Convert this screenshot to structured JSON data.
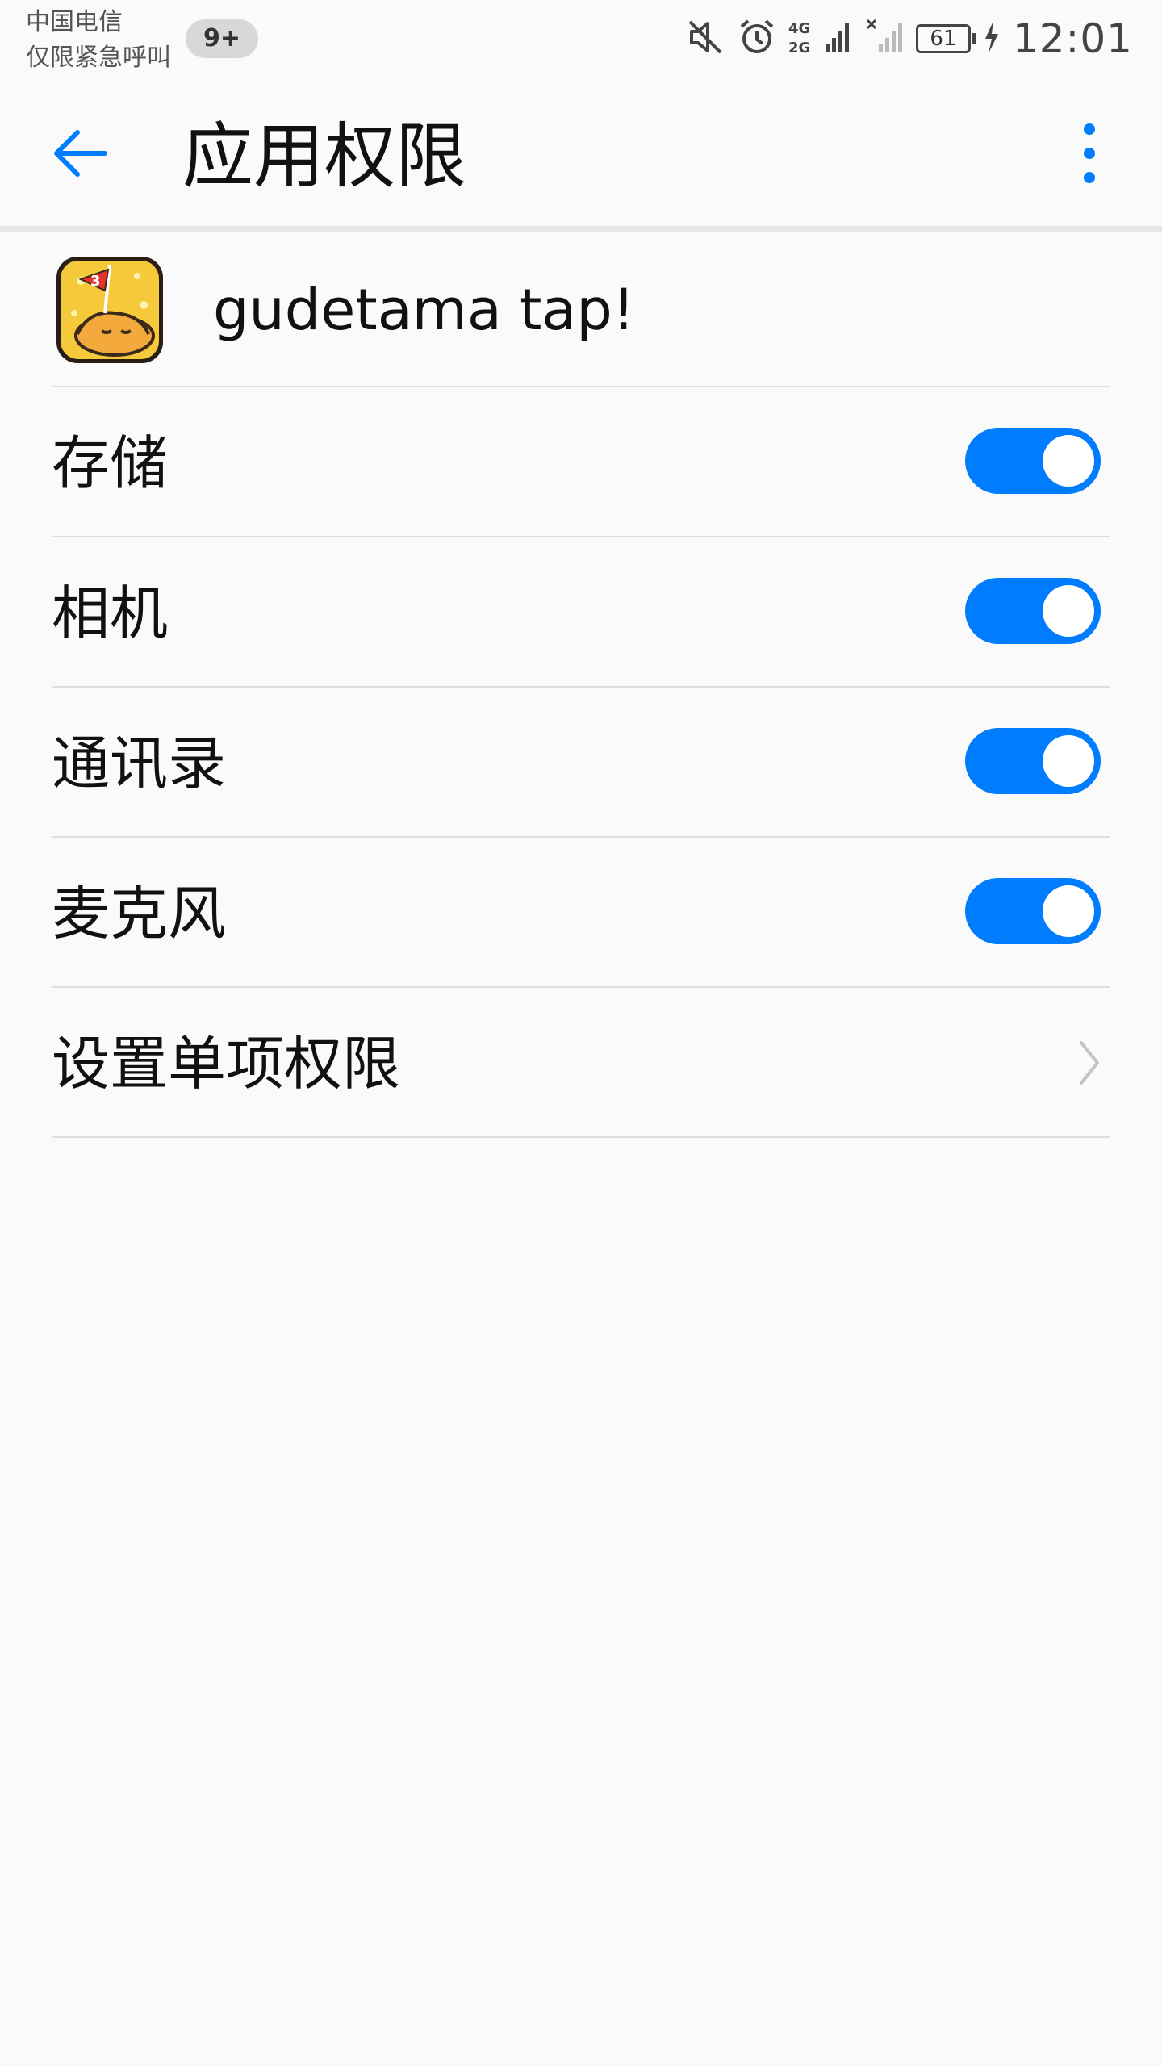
{
  "status_bar": {
    "carrier_line1": "中国电信",
    "carrier_line2": "仅限紧急呼叫",
    "notification_count": "9+",
    "network_label_top": "4G",
    "network_label_bottom": "2G",
    "battery_level": "61",
    "time": "12:01"
  },
  "app_bar": {
    "title": "应用权限",
    "back_icon": "arrow-left-icon",
    "more_icon": "more-vertical-icon"
  },
  "app": {
    "name": "gudetama tap!",
    "icon_badge": "3"
  },
  "permissions": [
    {
      "label": "存储",
      "enabled": true
    },
    {
      "label": "相机",
      "enabled": true
    },
    {
      "label": "通讯录",
      "enabled": true
    },
    {
      "label": "麦克风",
      "enabled": true
    }
  ],
  "settings_link": {
    "label": "设置单项权限",
    "icon": "chevron-right-icon"
  },
  "colors": {
    "accent": "#007dff",
    "background": "#fafafa",
    "divider": "#dedede"
  }
}
